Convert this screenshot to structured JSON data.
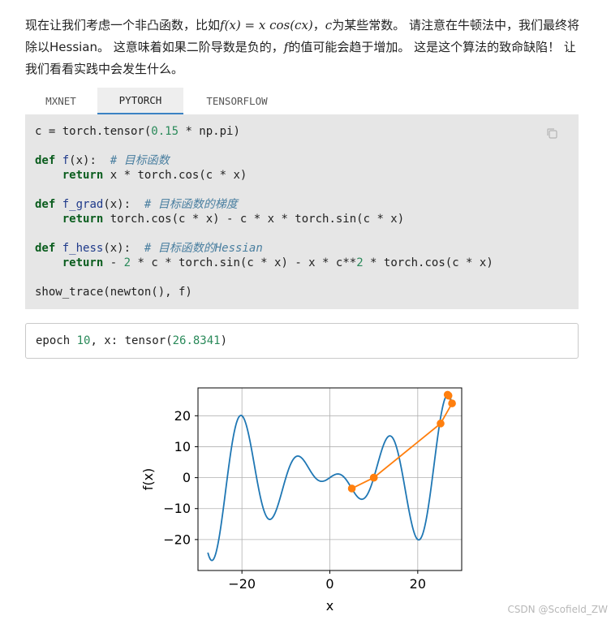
{
  "intro": {
    "p1": "现在让我们考虑一个非凸函数，比如",
    "formula": "f(x) = x cos(cx)",
    "p2": "，",
    "c_var": "c",
    "p3": "为某些常数。 请注意在牛顿法中，我们最终将除以Hessian。 这意味着如果二阶导数是负的，",
    "f_var": "f",
    "p4": "的值可能会趋于增加。 这是这个算法的致命缺陷！ 让我们看看实践中会发生什么。"
  },
  "tabs": [
    {
      "label": "MXNET",
      "active": false
    },
    {
      "label": "PYTORCH",
      "active": true
    },
    {
      "label": "TENSORFLOW",
      "active": false
    }
  ],
  "code": {
    "l1a": "c = torch.tensor(",
    "l1n": "0.15",
    "l1b": " * np.pi)",
    "def": "def",
    "ret": "return",
    "f_name": "f",
    "f_args": "(x):  ",
    "f_comment": "# 目标函数",
    "f_body": " x * torch.cos(c * x)",
    "g_name": "f_grad",
    "g_args": "(x):  ",
    "g_comment": "# 目标函数的梯度",
    "g_body": " torch.cos(c * x) - c * x * torch.sin(c * x)",
    "h_name": "f_hess",
    "h_args": "(x):  ",
    "h_comment": "# 目标函数的Hessian",
    "h_b1": " - ",
    "h_n1": "2",
    "h_b2": " * c * torch.sin(c * x) - x * c**",
    "h_n2": "2",
    "h_b3": " * torch.cos(c * x)",
    "last": "show_trace(newton(), f)"
  },
  "output": {
    "a": "epoch ",
    "epoch": "10",
    "b": ", x: tensor(",
    "x": "26.8341",
    "c": ")"
  },
  "watermark": "CSDN @Scofield_ZW",
  "chart_data": {
    "type": "line",
    "xlabel": "x",
    "ylabel": "f(x)",
    "xlim": [
      -30,
      30
    ],
    "ylim": [
      -30,
      29
    ],
    "xticks": [
      -20,
      0,
      20
    ],
    "yticks": [
      -20,
      -10,
      0,
      10,
      20
    ],
    "xtick_labels": [
      "−20",
      "0",
      "20"
    ],
    "ytick_labels": [
      "−20",
      "−10",
      "0",
      "10",
      "20"
    ],
    "grid": true,
    "function": "x*cos(0.15*pi*x)",
    "x_range": [
      -27.75,
      27.75
    ],
    "series": [
      {
        "color": "#1f77b4"
      },
      {
        "color": "#ff7f0e",
        "x": [
          10.0,
          5.0,
          10.0,
          25.2,
          27.8,
          26.8,
          27.0
        ],
        "y": [
          0.0,
          -3.5,
          0.0,
          17.5,
          24.0,
          26.8,
          26.5
        ]
      }
    ]
  }
}
